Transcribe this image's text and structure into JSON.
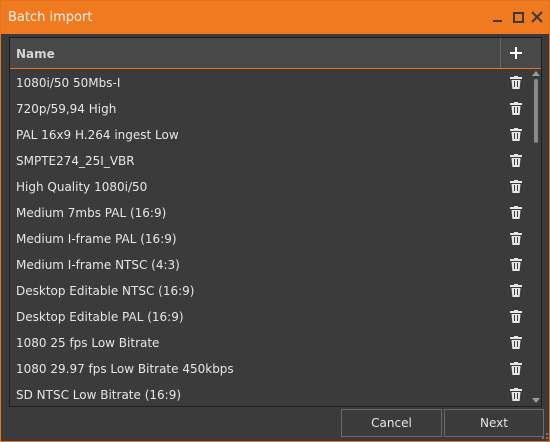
{
  "window": {
    "title": "Batch import"
  },
  "list": {
    "column_name": "Name",
    "items": [
      "1080i/50 50Mbs-I",
      "720p/59,94 High",
      "PAL 16x9 H.264 ingest Low",
      "SMPTE274_25I_VBR",
      "High Quality 1080i/50",
      "Medium 7mbs PAL (16:9)",
      "Medium I-frame PAL (16:9)",
      "Medium I-frame NTSC (4:3)",
      "Desktop Editable NTSC (16:9)",
      "Desktop Editable PAL (16:9)",
      "1080 25 fps Low Bitrate",
      "1080 29.97 fps Low Bitrate  450kbps",
      "SD NTSC Low Bitrate (16:9)"
    ]
  },
  "buttons": {
    "cancel": "Cancel",
    "next": "Next"
  },
  "icons": {
    "add": "plus-icon",
    "delete": "trash-icon",
    "minimize": "minimize-icon",
    "maximize": "maximize-icon",
    "close": "close-icon"
  },
  "colors": {
    "accent": "#f07a1f",
    "background": "#3b3b3b"
  }
}
